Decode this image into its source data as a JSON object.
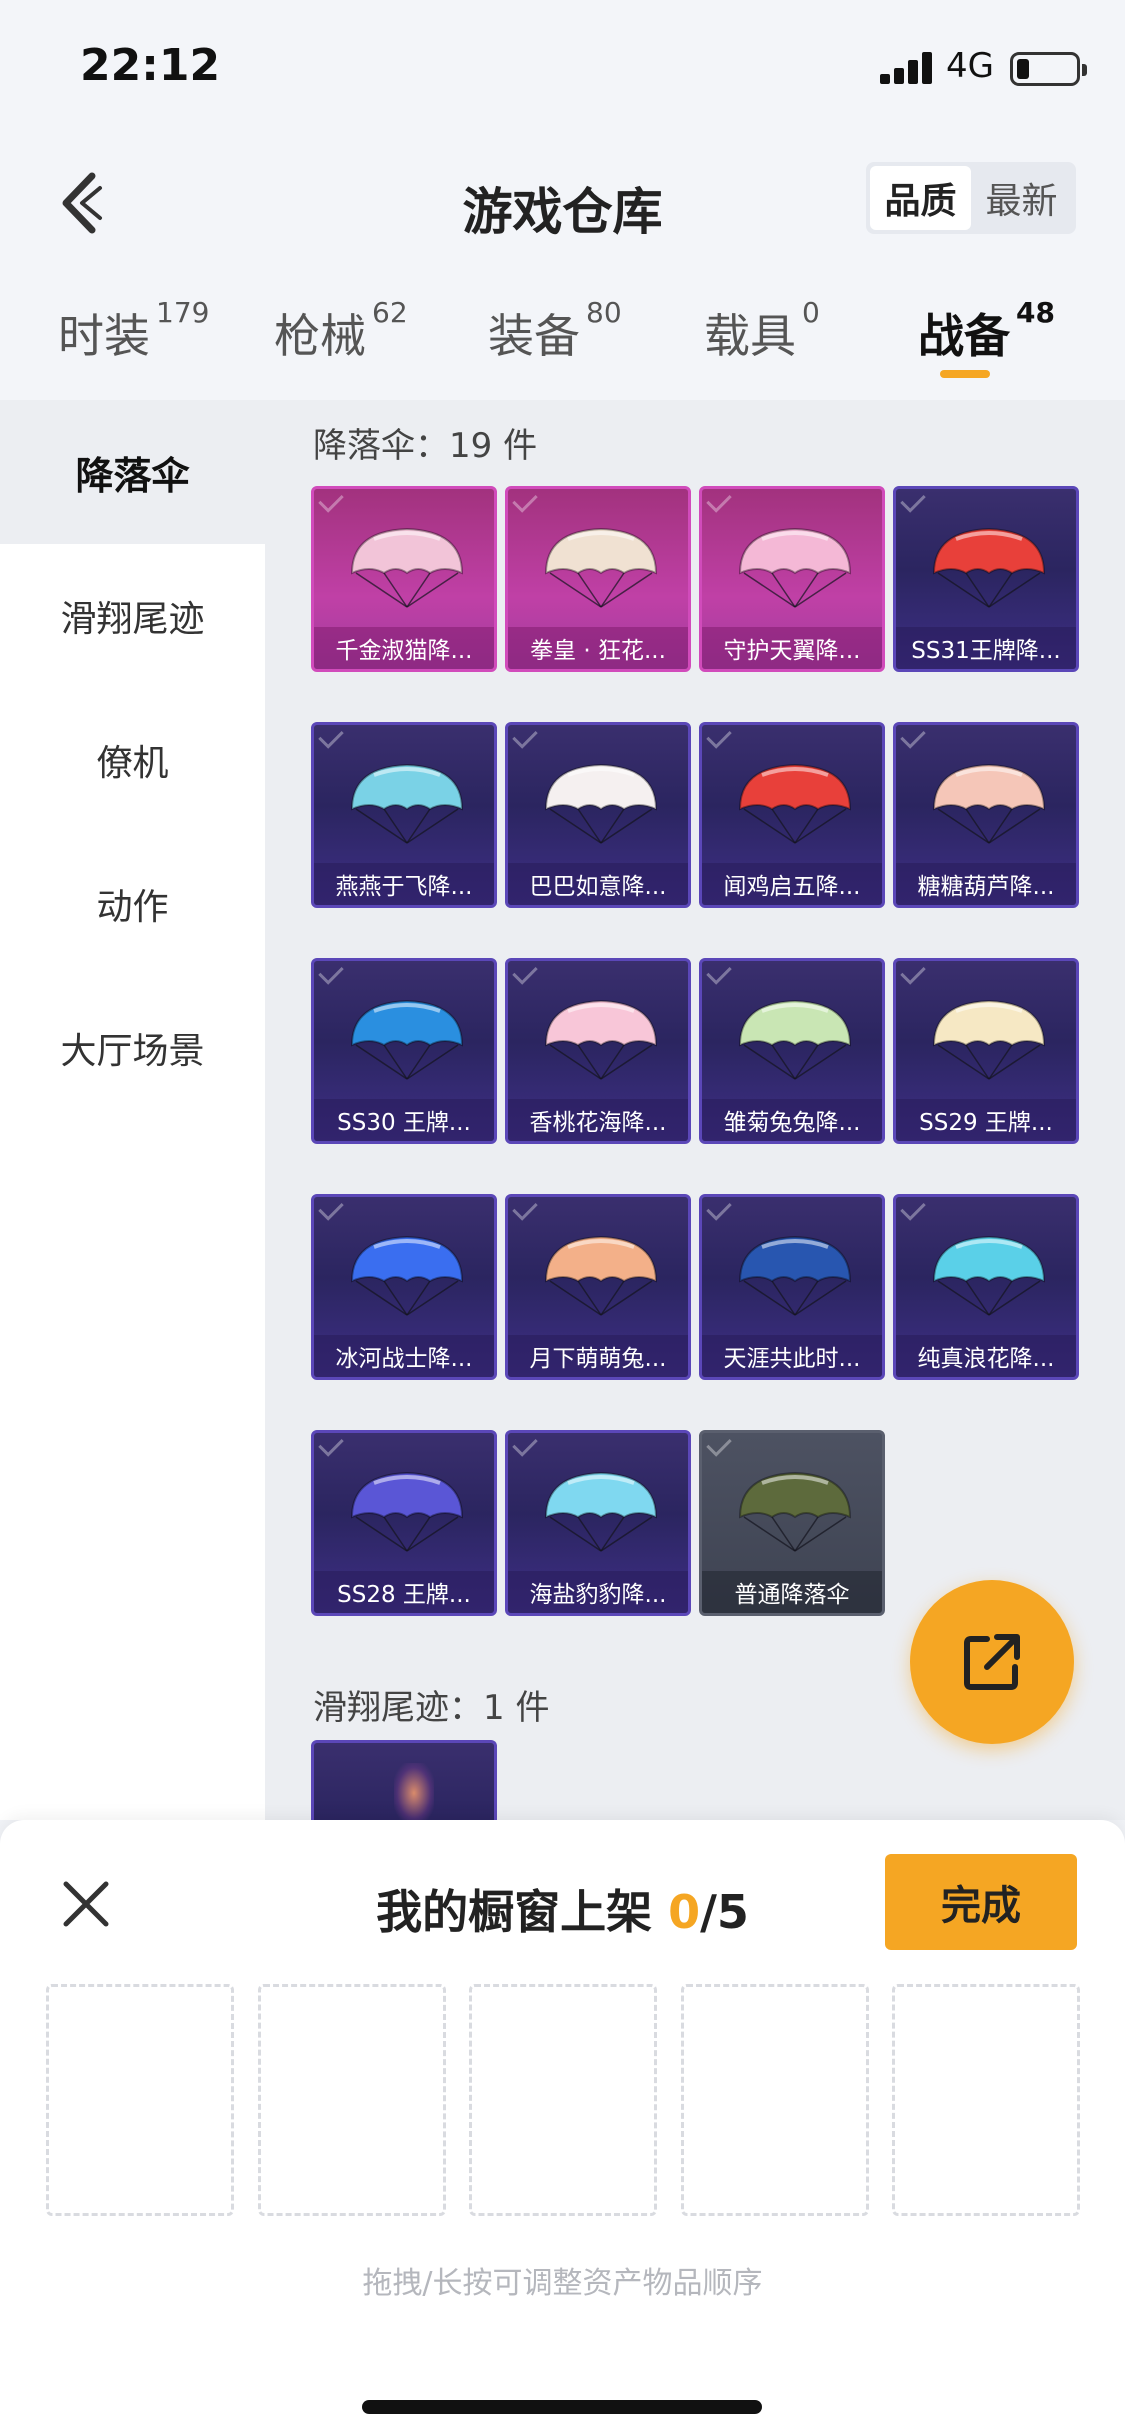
{
  "status_bar": {
    "time": "22:12",
    "network": "4G"
  },
  "header": {
    "title": "游戏仓库",
    "sort_options": [
      "品质",
      "最新"
    ],
    "sort_active": "品质"
  },
  "tabs": [
    {
      "label": "时装",
      "count": "179"
    },
    {
      "label": "枪械",
      "count": "62"
    },
    {
      "label": "装备",
      "count": "80"
    },
    {
      "label": "载具",
      "count": "0"
    },
    {
      "label": "战备",
      "count": "48"
    }
  ],
  "active_tab": "战备",
  "sidebar": {
    "items": [
      "降落伞",
      "滑翔尾迹",
      "僚机",
      "动作",
      "大厅场景"
    ]
  },
  "sections": {
    "parachute_title": "降落伞：19 件",
    "glide_title": "滑翔尾迹：1 件"
  },
  "items": [
    {
      "name": "千金淑猫降...",
      "rarity": "legend",
      "color": "#f2c4d8"
    },
    {
      "name": "拳皇 · 狂花...",
      "rarity": "legend",
      "color": "#f0e1d2"
    },
    {
      "name": "守护天翼降...",
      "rarity": "legend",
      "color": "#f4b8d6"
    },
    {
      "name": "SS31王牌降...",
      "rarity": "epic",
      "color": "#e8403a"
    },
    {
      "name": "燕燕于飞降...",
      "rarity": "epic",
      "color": "#7ad2e6"
    },
    {
      "name": "巴巴如意降...",
      "rarity": "epic",
      "color": "#f5f0f0"
    },
    {
      "name": "闻鸡启五降...",
      "rarity": "epic",
      "color": "#e8403a"
    },
    {
      "name": "糖糖葫芦降...",
      "rarity": "epic",
      "color": "#f5c6b8"
    },
    {
      "name": "SS30 王牌...",
      "rarity": "epic",
      "color": "#2a8fe0"
    },
    {
      "name": "香桃花海降...",
      "rarity": "epic",
      "color": "#f8c6d8"
    },
    {
      "name": "雏菊兔兔降...",
      "rarity": "epic",
      "color": "#c9e6b4"
    },
    {
      "name": "SS29 王牌...",
      "rarity": "epic",
      "color": "#f6e8c4"
    },
    {
      "name": "冰河战士降...",
      "rarity": "epic",
      "color": "#3a6ef0"
    },
    {
      "name": "月下萌萌兔...",
      "rarity": "epic",
      "color": "#f3b089"
    },
    {
      "name": "天涯共此时...",
      "rarity": "epic",
      "color": "#2856b0"
    },
    {
      "name": "纯真浪花降...",
      "rarity": "epic",
      "color": "#5ad0e8"
    },
    {
      "name": "SS28 王牌...",
      "rarity": "epic",
      "color": "#5a56d6"
    },
    {
      "name": "海盐豹豹降...",
      "rarity": "epic",
      "color": "#7fd8f0"
    },
    {
      "name": "普通降落伞",
      "rarity": "common",
      "color": "#5d6a3c"
    }
  ],
  "showcase": {
    "title_prefix": "我的橱窗上架 ",
    "count": "0",
    "total": "/5",
    "done_label": "完成",
    "slots": 5,
    "hint": "拖拽/长按可调整资产物品顺序"
  },
  "colors": {
    "accent": "#f5a623",
    "epic": "#5b47b8",
    "legend": "#c040a6"
  }
}
